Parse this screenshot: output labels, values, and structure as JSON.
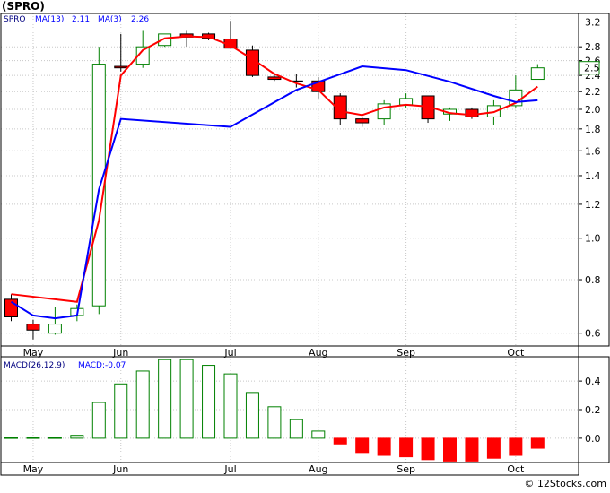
{
  "title": "(SPRO)",
  "watermark": "© 12Stocks.com",
  "colors": {
    "up_candle": "#008000",
    "down_candle": "#ff0000",
    "ma_fast": "#ff0000",
    "ma_slow": "#0000ff",
    "macd_up": "#008000",
    "macd_down": "#ff0000",
    "last_price_box": "#008000"
  },
  "chart_data": [
    {
      "type": "candlestick",
      "legend": {
        "symbol": "SPRO",
        "ma13_label": "MA(13)",
        "ma13_value": "2.11",
        "ma3_label": "MA(3)",
        "ma3_value": "2.26"
      },
      "y_scale": "log",
      "ylim": [
        0.56,
        3.35
      ],
      "y_ticks": [
        0.6,
        0.8,
        1.0,
        1.2,
        1.4,
        1.6,
        1.8,
        2.0,
        2.2,
        2.4,
        2.6,
        2.8,
        3.2
      ],
      "y_tick_labels": [
        "0.6",
        "0.8",
        "1.0",
        "1.2",
        "1.4",
        "1.6",
        "1.8",
        "2.0",
        "2.2",
        "2.4",
        "2.6",
        "2.8",
        "3.2"
      ],
      "x_ticks": [
        {
          "index": 1,
          "label": "May"
        },
        {
          "index": 5,
          "label": "Jun"
        },
        {
          "index": 10,
          "label": "Jul"
        },
        {
          "index": 14,
          "label": "Aug"
        },
        {
          "index": 18,
          "label": "Sep"
        },
        {
          "index": 23,
          "label": "Oct"
        }
      ],
      "last_price_label": "2.5",
      "last_price": 2.5,
      "grid": true,
      "candles": [
        {
          "open": 0.72,
          "high": 0.74,
          "low": 0.64,
          "close": 0.655
        },
        {
          "open": 0.63,
          "high": 0.645,
          "low": 0.58,
          "close": 0.61
        },
        {
          "open": 0.6,
          "high": 0.69,
          "low": 0.595,
          "close": 0.63
        },
        {
          "open": 0.66,
          "high": 0.7,
          "low": 0.64,
          "close": 0.685
        },
        {
          "open": 0.695,
          "high": 2.8,
          "low": 0.665,
          "close": 2.55
        },
        {
          "open": 2.52,
          "high": 3.0,
          "low": 2.45,
          "close": 2.5
        },
        {
          "open": 2.55,
          "high": 3.05,
          "low": 2.5,
          "close": 2.8
        },
        {
          "open": 2.82,
          "high": 3.0,
          "low": 2.8,
          "close": 3.0
        },
        {
          "open": 3.0,
          "high": 3.05,
          "low": 2.8,
          "close": 2.95
        },
        {
          "open": 3.0,
          "high": 3.02,
          "low": 2.9,
          "close": 2.93
        },
        {
          "open": 2.92,
          "high": 3.22,
          "low": 2.78,
          "close": 2.78
        },
        {
          "open": 2.75,
          "high": 2.82,
          "low": 2.38,
          "close": 2.4
        },
        {
          "open": 2.38,
          "high": 2.42,
          "low": 2.33,
          "close": 2.35
        },
        {
          "open": 2.33,
          "high": 2.42,
          "low": 2.25,
          "close": 2.32
        },
        {
          "open": 2.33,
          "high": 2.38,
          "low": 2.12,
          "close": 2.2
        },
        {
          "open": 2.15,
          "high": 2.18,
          "low": 1.84,
          "close": 1.9
        },
        {
          "open": 1.9,
          "high": 1.92,
          "low": 1.82,
          "close": 1.86
        },
        {
          "open": 1.9,
          "high": 2.1,
          "low": 1.84,
          "close": 2.06
        },
        {
          "open": 2.05,
          "high": 2.18,
          "low": 2.02,
          "close": 2.12
        },
        {
          "open": 2.15,
          "high": 2.15,
          "low": 1.86,
          "close": 1.9
        },
        {
          "open": 1.95,
          "high": 2.02,
          "low": 1.88,
          "close": 2.0
        },
        {
          "open": 2.0,
          "high": 2.02,
          "low": 1.9,
          "close": 1.92
        },
        {
          "open": 1.92,
          "high": 2.1,
          "low": 1.84,
          "close": 2.04
        },
        {
          "open": 2.04,
          "high": 2.4,
          "low": 2.02,
          "close": 2.22
        },
        {
          "open": 2.35,
          "high": 2.55,
          "low": 2.35,
          "close": 2.5
        }
      ],
      "ma13": [
        {
          "x": 0,
          "y": 0.74
        },
        {
          "x": 3,
          "y": 0.71
        },
        {
          "x": 4,
          "y": 1.1
        },
        {
          "x": 5,
          "y": 2.4
        },
        {
          "x": 6,
          "y": 2.75
        },
        {
          "x": 7,
          "y": 2.93
        },
        {
          "x": 8,
          "y": 2.96
        },
        {
          "x": 9,
          "y": 2.95
        },
        {
          "x": 10,
          "y": 2.82
        },
        {
          "x": 11,
          "y": 2.62
        },
        {
          "x": 12,
          "y": 2.42
        },
        {
          "x": 13,
          "y": 2.3
        },
        {
          "x": 14,
          "y": 2.22
        },
        {
          "x": 15,
          "y": 1.98
        },
        {
          "x": 16,
          "y": 1.94
        },
        {
          "x": 17,
          "y": 2.02
        },
        {
          "x": 18,
          "y": 2.05
        },
        {
          "x": 19,
          "y": 2.03
        },
        {
          "x": 20,
          "y": 1.96
        },
        {
          "x": 21,
          "y": 1.94
        },
        {
          "x": 22,
          "y": 1.97
        },
        {
          "x": 23,
          "y": 2.07
        },
        {
          "x": 24,
          "y": 2.26
        }
      ],
      "ma3": [
        {
          "x": 0,
          "y": 0.71
        },
        {
          "x": 1,
          "y": 0.66
        },
        {
          "x": 2,
          "y": 0.65
        },
        {
          "x": 3,
          "y": 0.66
        },
        {
          "x": 4,
          "y": 1.3
        },
        {
          "x": 5,
          "y": 1.9
        },
        {
          "x": 10,
          "y": 1.82
        },
        {
          "x": 13,
          "y": 2.22
        },
        {
          "x": 16,
          "y": 2.52
        },
        {
          "x": 18,
          "y": 2.47
        },
        {
          "x": 20,
          "y": 2.32
        },
        {
          "x": 22,
          "y": 2.15
        },
        {
          "x": 23,
          "y": 2.08
        },
        {
          "x": 24,
          "y": 2.1
        }
      ]
    },
    {
      "type": "bar",
      "legend": {
        "label": "MACD(26,12,9)",
        "value_label": "MACD:-0.07"
      },
      "ylim": [
        -0.17,
        0.57
      ],
      "y_ticks": [
        0.0,
        0.2,
        0.4
      ],
      "y_tick_labels": [
        "0.0",
        "0.2",
        "0.4"
      ],
      "x_ticks": [
        {
          "index": 1,
          "label": "May"
        },
        {
          "index": 5,
          "label": "Jun"
        },
        {
          "index": 10,
          "label": "Jul"
        },
        {
          "index": 14,
          "label": "Aug"
        },
        {
          "index": 18,
          "label": "Sep"
        },
        {
          "index": 23,
          "label": "Oct"
        }
      ],
      "grid": true,
      "values": [
        0.005,
        0.005,
        0.005,
        0.02,
        0.25,
        0.38,
        0.47,
        0.55,
        0.55,
        0.51,
        0.45,
        0.32,
        0.22,
        0.13,
        0.05,
        -0.04,
        -0.1,
        -0.12,
        -0.13,
        -0.15,
        -0.16,
        -0.16,
        -0.14,
        -0.12,
        -0.07
      ]
    }
  ]
}
